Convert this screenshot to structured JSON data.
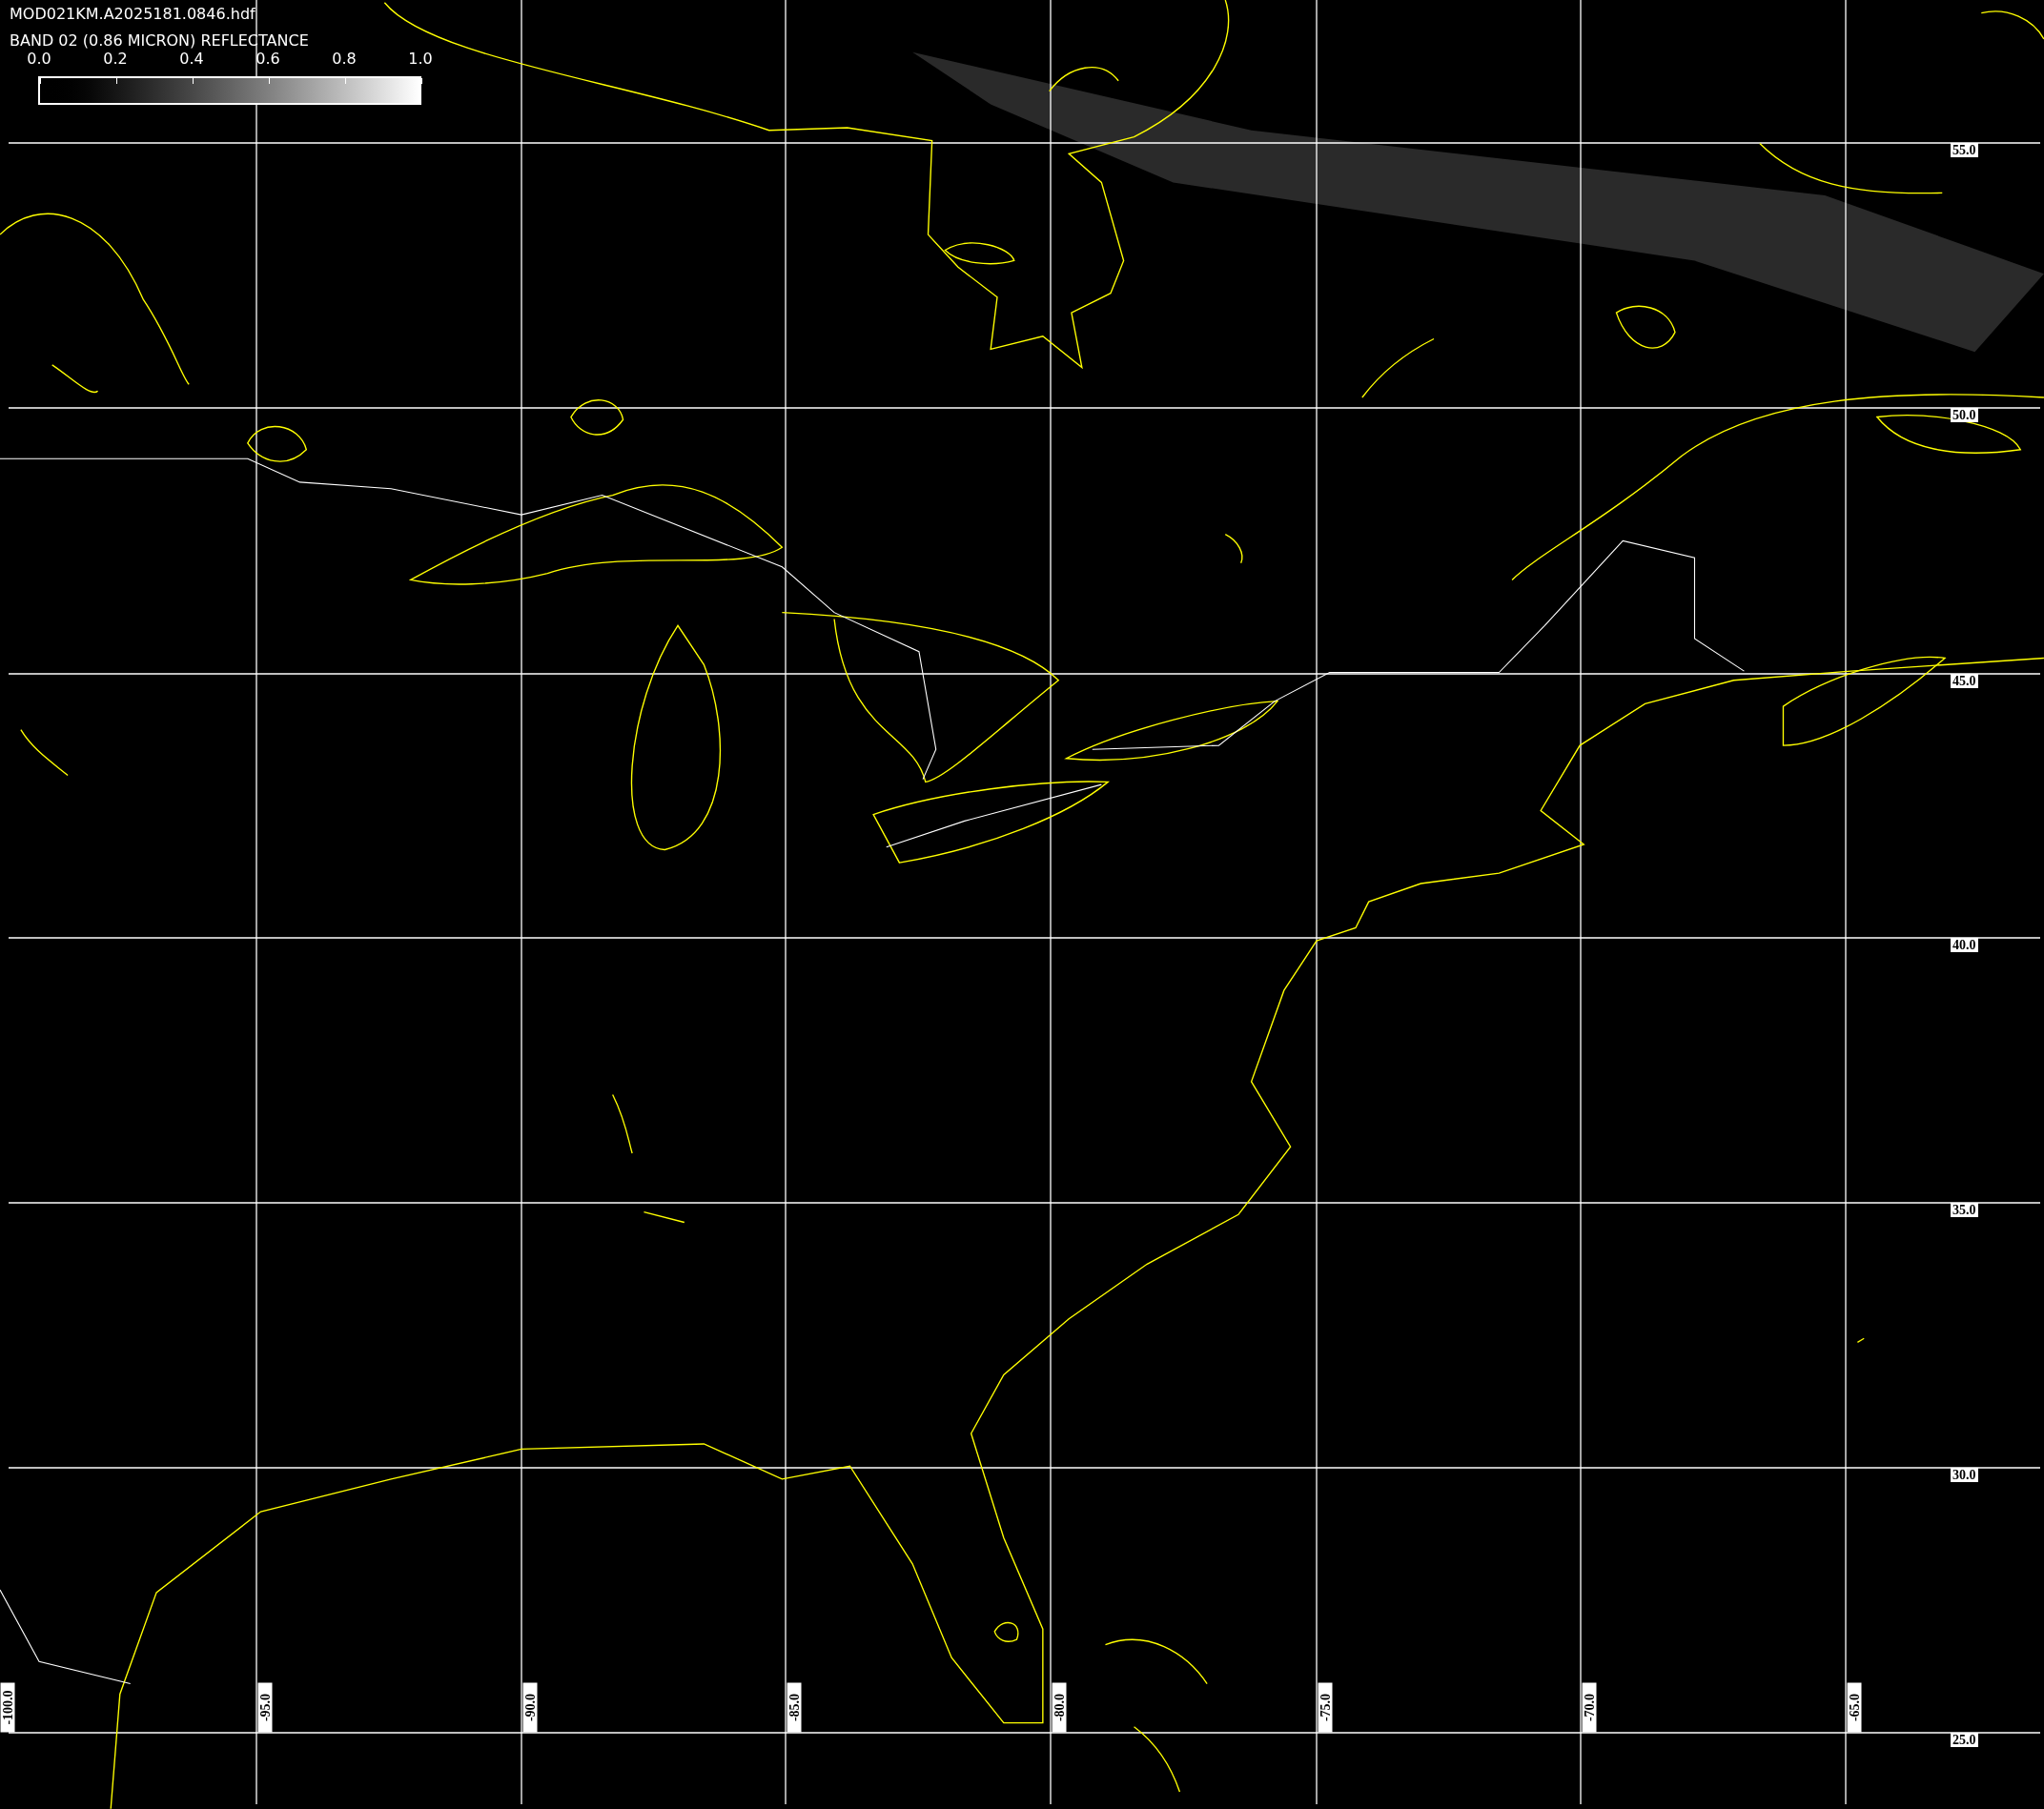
{
  "header": {
    "file_name": "MOD021KM.A2025181.0846.hdf",
    "band_title": "BAND 02 (0.86 MICRON) REFLECTANCE"
  },
  "colorbar": {
    "ticks": [
      "0.0",
      "0.2",
      "0.4",
      "0.6",
      "0.8",
      "1.0"
    ]
  },
  "map": {
    "latitude_labels": [
      "55.0",
      "50.0",
      "45.0",
      "40.0",
      "35.0",
      "30.0",
      "25.0"
    ],
    "longitude_labels": [
      "-100.0",
      "-95.0",
      "-90.0",
      "-85.0",
      "-80.0",
      "-75.0",
      "-70.0",
      "-65.0"
    ]
  }
}
